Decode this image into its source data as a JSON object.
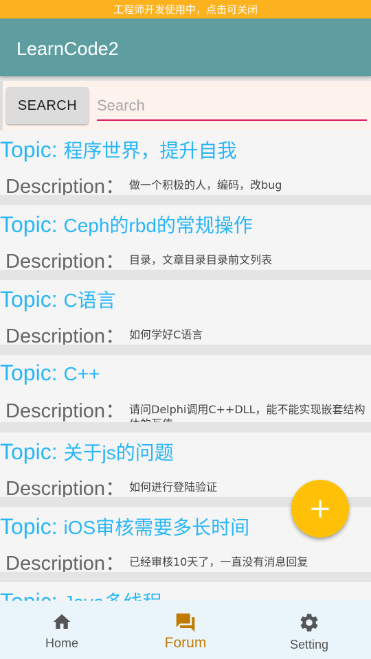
{
  "dev_banner": "工程师开发使用中，点击可关闭",
  "app_bar": {
    "title": "LearnCode2"
  },
  "search": {
    "button_label": "SEARCH",
    "placeholder": "Search",
    "value": ""
  },
  "colors": {
    "app_bar": "#5f9ea0",
    "accent_topic": "#29b6f6",
    "fab": "#ffc107",
    "input_underline": "#d81b60",
    "nav_active": "#c17a00",
    "banner": "#fbb21e"
  },
  "topics": [
    {
      "topic_label": "Topic:",
      "topic": "程序世界，提升自我",
      "desc_label": "Description：",
      "description": "做一个积极的人，编码，改bug"
    },
    {
      "topic_label": "Topic:",
      "topic": "Ceph的rbd的常规操作",
      "desc_label": "Description：",
      "description": "目录，文章目录目录前文列表"
    },
    {
      "topic_label": "Topic:",
      "topic": "C语言",
      "desc_label": "Description：",
      "description": "如何学好C语言"
    },
    {
      "topic_label": "Topic:",
      "topic": "C++",
      "desc_label": "Description：",
      "description": "请问Delphi调用C++DLL，能不能实现嵌套结构体的互传"
    },
    {
      "topic_label": "Topic:",
      "topic": "关于js的问题",
      "desc_label": "Description：",
      "description": "如何进行登陆验证"
    },
    {
      "topic_label": "Topic:",
      "topic": "iOS审核需要多长时间",
      "desc_label": "Description：",
      "description": "已经审核10天了，一直没有消息回复"
    },
    {
      "topic_label": "Topic:",
      "topic": "Java多线程",
      "desc_label": "Description：",
      "description": ""
    }
  ],
  "fab": {
    "icon": "plus-icon",
    "label": "+"
  },
  "bottom_nav": {
    "items": [
      {
        "label": "Home",
        "icon": "home-icon",
        "active": false
      },
      {
        "label": "Forum",
        "icon": "forum-icon",
        "active": true
      },
      {
        "label": "Setting",
        "icon": "gear-icon",
        "active": false
      }
    ]
  }
}
